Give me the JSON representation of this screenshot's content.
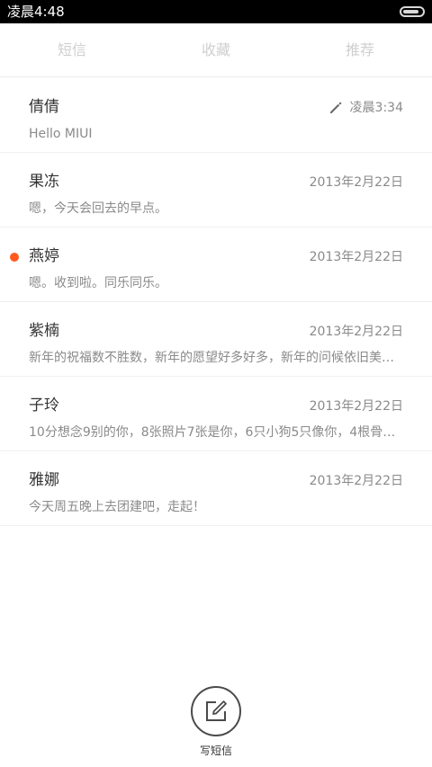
{
  "status_bar": {
    "time": "凌晨4:48",
    "battery_level": 0.85
  },
  "tabs": [
    {
      "label": "短信",
      "active": true
    },
    {
      "label": "收藏",
      "active": false
    },
    {
      "label": "推荐",
      "active": false
    }
  ],
  "conversations": [
    {
      "name": "倩倩",
      "date": "凌晨3:34",
      "preview": "Hello MIUI",
      "draft": true,
      "unread": false
    },
    {
      "name": "果冻",
      "date": "2013年2月22日",
      "preview": "嗯，今天会回去的早点。",
      "draft": false,
      "unread": false
    },
    {
      "name": "燕婷",
      "date": "2013年2月22日",
      "preview": "嗯。收到啦。同乐同乐。",
      "draft": false,
      "unread": true
    },
    {
      "name": "紫楠",
      "date": "2013年2月22日",
      "preview": "新年的祝福数不胜数，新年的愿望好多好多，新年的问候依旧美好…",
      "draft": false,
      "unread": false
    },
    {
      "name": "子玲",
      "date": "2013年2月22日",
      "preview": "10分想念9别的你，8张照片7张是你，6只小狗5只像你，4根骨头…",
      "draft": false,
      "unread": false
    },
    {
      "name": "雅娜",
      "date": "2013年2月22日",
      "preview": "今天周五晚上去团建吧，走起！",
      "draft": false,
      "unread": false
    }
  ],
  "compose": {
    "label": "写短信",
    "icon": "compose-icon"
  },
  "colors": {
    "unread_dot": "#ff5a1f",
    "status_bar_bg": "#000000",
    "active_tab": "#333333",
    "inactive_tab": "#cfcfcf"
  }
}
